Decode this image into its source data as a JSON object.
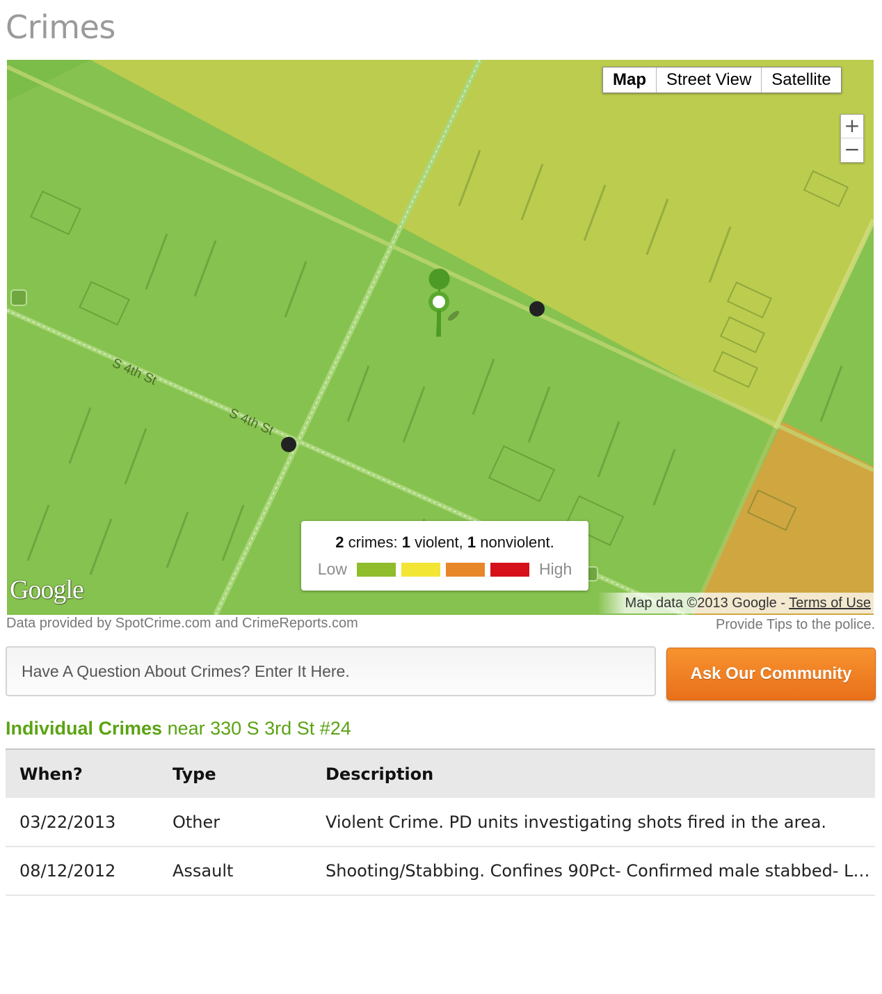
{
  "page": {
    "title": "Crimes"
  },
  "map": {
    "type_controls": [
      "Map",
      "Street View",
      "Satellite"
    ],
    "active_type": "Map",
    "zoom": {
      "in": "+",
      "out": "−"
    },
    "street_labels": [
      "S 4th St",
      "S 4th St"
    ],
    "legend": {
      "total": "2",
      "crimes_word": "crimes:",
      "violent_count": "1",
      "violent_word": "violent,",
      "nonviolent_count": "1",
      "nonviolent_word": "nonviolent.",
      "low_label": "Low",
      "high_label": "High",
      "scale_colors": [
        "#8fbd2c",
        "#f2e534",
        "#e8862a",
        "#d6101a"
      ]
    },
    "logo_text": "Google",
    "attribution": {
      "text": "Map data ©2013 Google - ",
      "terms": "Terms of Use"
    },
    "zone_colors": {
      "low": "#86c24f",
      "medium": "#bccc4f",
      "high": "#cfa640"
    }
  },
  "sources": {
    "data_provided": "Data provided by SpotCrime.com and CrimeReports.com",
    "provide_tips": "Provide Tips to the police."
  },
  "question": {
    "placeholder": "Have A Question About Crimes? Enter It Here.",
    "button_label": "Ask Our Community"
  },
  "crimes_section": {
    "heading_strong": "Individual Crimes",
    "heading_rest": " near 330 S 3rd St #24",
    "columns": [
      "When?",
      "Type",
      "Description"
    ],
    "rows": [
      {
        "when": "03/22/2013",
        "type": "Other",
        "description": "Violent Crime. PD units investigating shots fired in the area."
      },
      {
        "when": "08/12/2012",
        "type": "Assault",
        "description": "Shooting/Stabbing. Confines 90Pct- Confirmed male stabbed- L…"
      }
    ]
  }
}
